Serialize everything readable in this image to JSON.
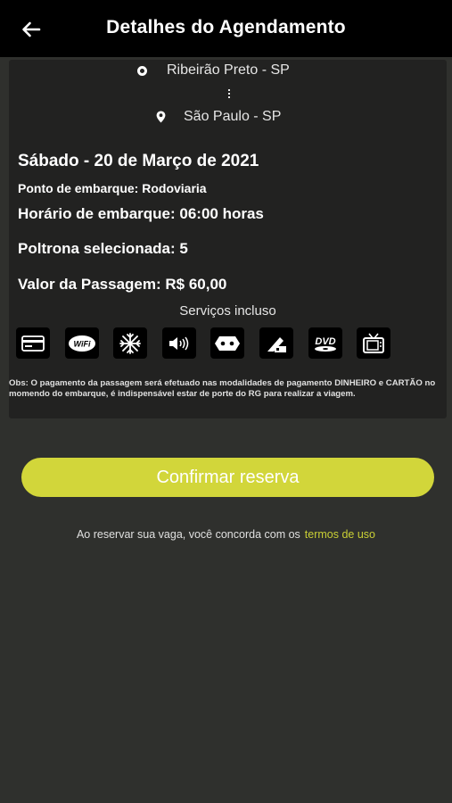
{
  "header": {
    "title": "Detalhes do Agendamento",
    "back_icon": "arrow-left-icon"
  },
  "route": {
    "origin": "Ribeirão Preto - SP",
    "destination": "São Paulo - SP",
    "origin_icon": "circle-icon",
    "destination_icon": "map-pin-icon"
  },
  "trip": {
    "date": "Sábado - 20 de Março de 2021",
    "boarding_point": "Ponto de embarque: Rodoviaria",
    "boarding_time": "Horário de embarque: 06:00 horas",
    "seat": "Poltrona selecionada: 5",
    "price": "Valor da Passagem: R$ 60,00"
  },
  "services": {
    "title": "Serviços incluso",
    "icons": [
      "credit-card-icon",
      "wifi-icon",
      "air-conditioning-icon",
      "audio-icon",
      "power-outlet-icon",
      "reclining-seat-icon",
      "dvd-icon",
      "tv-icon"
    ],
    "wifi_label": "WiFi",
    "dvd_label": "DVD"
  },
  "note": "Obs: O pagamento da passagem será efetuado nas modalidades de pagamento DINHEIRO e CARTÃO no momendo do embarque, é indispensável estar de porte do RG para realizar a viagem.",
  "actions": {
    "confirm_label": "Confirmar reserva"
  },
  "terms": {
    "text": "Ao reservar sua vaga, você concorda com os",
    "link": "termos de uso"
  },
  "colors": {
    "accent": "#d2d63a",
    "link": "#c9cf35",
    "background": "#2f302d",
    "card": "#222221",
    "header": "#000000"
  }
}
